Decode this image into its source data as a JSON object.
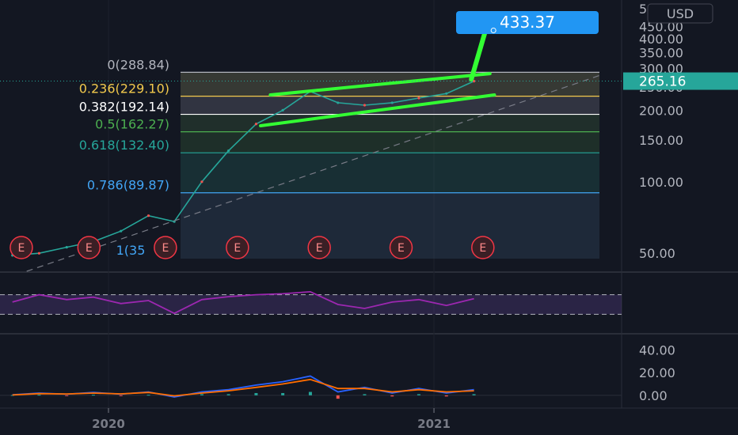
{
  "currency": "USD",
  "colors": {
    "background": "#131722",
    "axis_text": "#b2b5be",
    "fib_zero": "#b2b5be",
    "fib_236": "#f2c94c",
    "fib_382": "#ffffff",
    "fib_5": "#4caf50",
    "fib_618": "#26a69a",
    "fib_786": "#42a5f5",
    "channel": "#33ff33",
    "callout": "#2196f3",
    "last_price": "#26a69a",
    "rsi_line": "#9c27b0",
    "macd_line": "#2962ff",
    "signal_line": "#ff6d00",
    "earnings": "#f23645"
  },
  "earnings_label": "E",
  "chart_data": [
    {
      "type": "line",
      "panel": "price",
      "title": "",
      "y_scale": "log",
      "y_ticks": [
        "450.00",
        "400.00",
        "350.00",
        "300.00",
        "250.00",
        "200.00",
        "150.00",
        "100.00",
        "50.00"
      ],
      "y_tick_values": [
        450,
        400,
        350,
        300,
        250,
        200,
        150,
        100,
        50
      ],
      "y_top_partial": "5",
      "ylim": [
        42,
        560
      ],
      "xlim": [
        "2019-09-01",
        "2021-07-31"
      ],
      "last_price": 265.16,
      "last_price_label": "265.16",
      "target_label": "433.37",
      "target_value": 433.37,
      "series": [
        {
          "x": [
            "2019-09",
            "2019-10",
            "2019-11",
            "2019-12",
            "2020-01",
            "2020-02",
            "2020-03",
            "2020-04",
            "2020-05",
            "2020-06",
            "2020-07",
            "2020-08",
            "2020-09",
            "2020-10",
            "2020-11",
            "2020-12",
            "2021-01",
            "2021-02"
          ],
          "values": [
            49,
            50,
            53,
            56,
            62,
            72,
            68,
            100,
            135,
            175,
            200,
            240,
            215,
            210,
            215,
            225,
            235,
            265
          ]
        }
      ],
      "fibonacci_levels": [
        {
          "label": "0(288.84)",
          "value": 288.84
        },
        {
          "label": "0.236(229.10)",
          "value": 229.1
        },
        {
          "label": "0.382(192.14)",
          "value": 192.14
        },
        {
          "label": "0.5(162.27)",
          "value": 162.27
        },
        {
          "label": "0.618(132.40)",
          "value": 132.4
        },
        {
          "label": "0.786(89.87)",
          "value": 89.87
        },
        {
          "label": "1(35",
          "value": 35
        }
      ],
      "channel": {
        "upper": [
          {
            "x": "2020-07-01",
            "y": 232
          },
          {
            "x": "2021-03-05",
            "y": 285
          }
        ],
        "lower": [
          {
            "x": "2020-06-20",
            "y": 172
          },
          {
            "x": "2021-03-10",
            "y": 232
          }
        ]
      },
      "projection": [
        {
          "x": "2021-02-12",
          "y": 270
        },
        {
          "x": "2021-02-28",
          "y": 433.37
        }
      ],
      "earnings_dates": [
        "2019-09-25",
        "2019-12-10",
        "2020-03-05",
        "2020-05-25",
        "2020-08-25",
        "2020-11-25",
        "2021-02-25"
      ]
    },
    {
      "type": "line",
      "panel": "rsi",
      "title": "",
      "band": [
        30,
        70
      ],
      "ylim": [
        0,
        100
      ],
      "series": [
        {
          "x": [
            "2019-09",
            "2019-10",
            "2019-11",
            "2019-12",
            "2020-01",
            "2020-02",
            "2020-03",
            "2020-04",
            "2020-05",
            "2020-06",
            "2020-07",
            "2020-08",
            "2020-09",
            "2020-10",
            "2020-11",
            "2020-12",
            "2021-01",
            "2021-02"
          ],
          "values": [
            55,
            70,
            60,
            65,
            52,
            58,
            32,
            60,
            66,
            70,
            72,
            76,
            50,
            42,
            55,
            60,
            48,
            62
          ]
        }
      ]
    },
    {
      "type": "line",
      "panel": "macd",
      "title": "",
      "y_ticks": [
        "40.00",
        "20.00",
        "0.00"
      ],
      "y_tick_values": [
        40,
        20,
        0
      ],
      "ylim": [
        -5,
        48
      ],
      "x_ticks": [
        "2020",
        "2021"
      ],
      "x_tick_values": [
        "2020-01-01",
        "2021-01-01"
      ],
      "series": [
        {
          "name": "",
          "x": [
            "2019-09",
            "2019-10",
            "2019-11",
            "2019-12",
            "2020-01",
            "2020-02",
            "2020-03",
            "2020-04",
            "2020-05",
            "2020-06",
            "2020-07",
            "2020-08",
            "2020-09",
            "2020-10",
            "2020-11",
            "2020-12",
            "2021-01",
            "2021-02"
          ],
          "values": [
            0.5,
            2,
            1,
            2.5,
            1,
            3,
            -1.5,
            3,
            5,
            9,
            12,
            17,
            3,
            7,
            2,
            6,
            2,
            5
          ]
        },
        {
          "name": "",
          "x": [
            "2019-09",
            "2019-10",
            "2019-11",
            "2019-12",
            "2020-01",
            "2020-02",
            "2020-03",
            "2020-04",
            "2020-05",
            "2020-06",
            "2020-07",
            "2020-08",
            "2020-09",
            "2020-10",
            "2020-11",
            "2020-12",
            "2021-01",
            "2021-02"
          ],
          "values": [
            0.3,
            1.5,
            1.2,
            2,
            1.3,
            2.5,
            -0.5,
            2,
            4,
            7,
            10,
            14,
            6,
            6,
            3,
            5,
            3,
            4
          ]
        }
      ]
    }
  ]
}
